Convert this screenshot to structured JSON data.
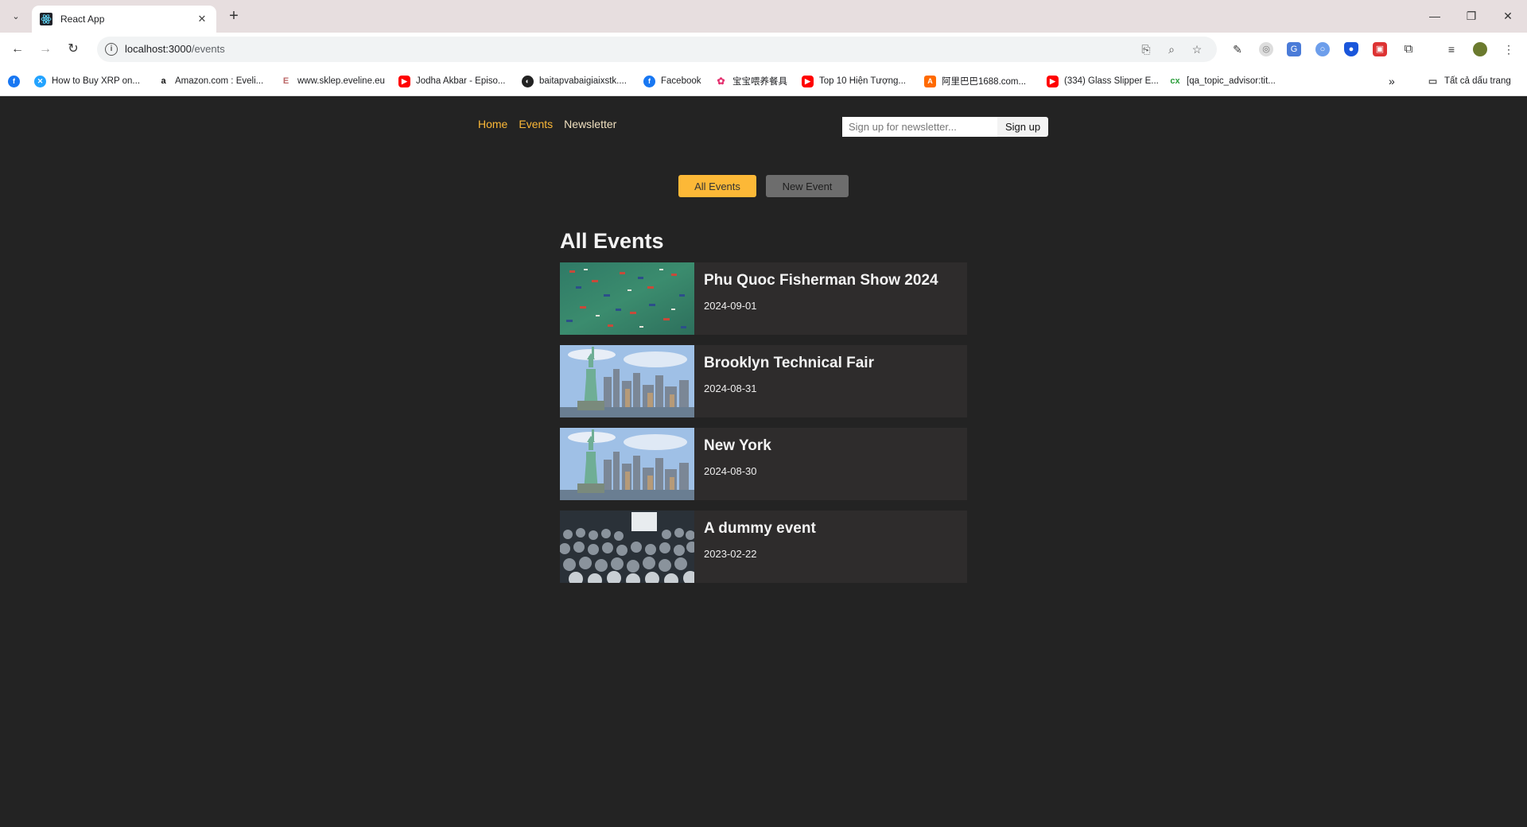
{
  "browser": {
    "tab_title": "React App",
    "url_host": "localhost:3000",
    "url_path": "/events"
  },
  "bookmarks": [
    {
      "label": "How to Buy XRP on...",
      "icon": "xrp-icon"
    },
    {
      "label": "Amazon.com : Eveli...",
      "icon": "amazon-icon"
    },
    {
      "label": "www.sklep.eveline.eu",
      "icon": "eveline-icon"
    },
    {
      "label": "Jodha Akbar - Episo...",
      "icon": "youtube-icon"
    },
    {
      "label": "baitapvabaigiaixstk....",
      "icon": "web-icon"
    },
    {
      "label": "Facebook",
      "icon": "facebook-icon"
    },
    {
      "label": "宝宝喂养餐具",
      "icon": "taobao-icon"
    },
    {
      "label": "Top 10 Hiện Tượng...",
      "icon": "youtube-icon"
    },
    {
      "label": "阿里巴巴1688.com...",
      "icon": "alibaba-icon"
    },
    {
      "label": "(334) Glass Slipper E...",
      "icon": "youtube-icon"
    },
    {
      "label": "[qa_topic_advisor:tit...",
      "icon": "cx-icon"
    }
  ],
  "bookmarks_folder": "Tất cả dấu trang",
  "main_nav": {
    "home": "Home",
    "events": "Events",
    "newsletter": "Newsletter"
  },
  "newsletter_form": {
    "placeholder": "Sign up for newsletter...",
    "button": "Sign up"
  },
  "events_nav": {
    "all_events": "All Events",
    "new_event": "New Event"
  },
  "heading": "All Events",
  "events": [
    {
      "title": "Phu Quoc Fisherman Show 2024",
      "date": "2024-09-01",
      "image": "boats-harbor"
    },
    {
      "title": "Brooklyn Technical Fair",
      "date": "2024-08-31",
      "image": "statue-of-liberty"
    },
    {
      "title": "New York",
      "date": "2024-08-30",
      "image": "statue-of-liberty"
    },
    {
      "title": "A dummy event",
      "date": "2023-02-22",
      "image": "crowd-audience"
    }
  ],
  "colors": {
    "accent": "#fcb837",
    "page_bg": "#232323",
    "card_bg": "#2e2c2c"
  }
}
